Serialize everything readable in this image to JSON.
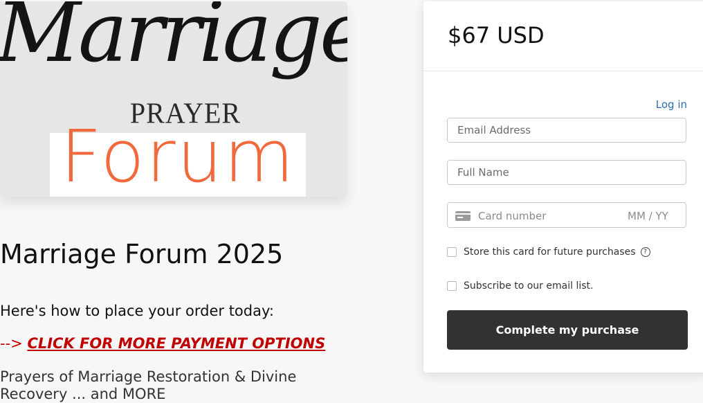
{
  "banner": {
    "script_text": "Marriage",
    "subtitle_text": "PRAYER",
    "forum_text": "Forum",
    "forum_color": "#f06a3e"
  },
  "product": {
    "title": "Marriage Forum 2025",
    "order_intro": "Here's how to place your order today:",
    "payment_arrow": "-->",
    "payment_link": "CLICK FOR MORE PAYMENT OPTIONS",
    "payment_link_color": "#c00000",
    "description": "Prayers of Marriage Restoration & Divine Recovery ... and MORE"
  },
  "checkout": {
    "price": "$67 USD",
    "login_label": "Log in",
    "email_placeholder": "Email Address",
    "fullname_placeholder": "Full Name",
    "card_number_placeholder": "Card number",
    "expiry_placeholder": "MM / YY",
    "card_icon": "credit-card-icon",
    "store_card_label": "Store this card for future purchases",
    "help_icon": "question-circle-icon",
    "help_glyph": "?",
    "subscribe_label": "Subscribe to our email list.",
    "submit_label": "Complete my purchase",
    "submit_color": "#333230",
    "link_color": "#2b6cb0"
  }
}
